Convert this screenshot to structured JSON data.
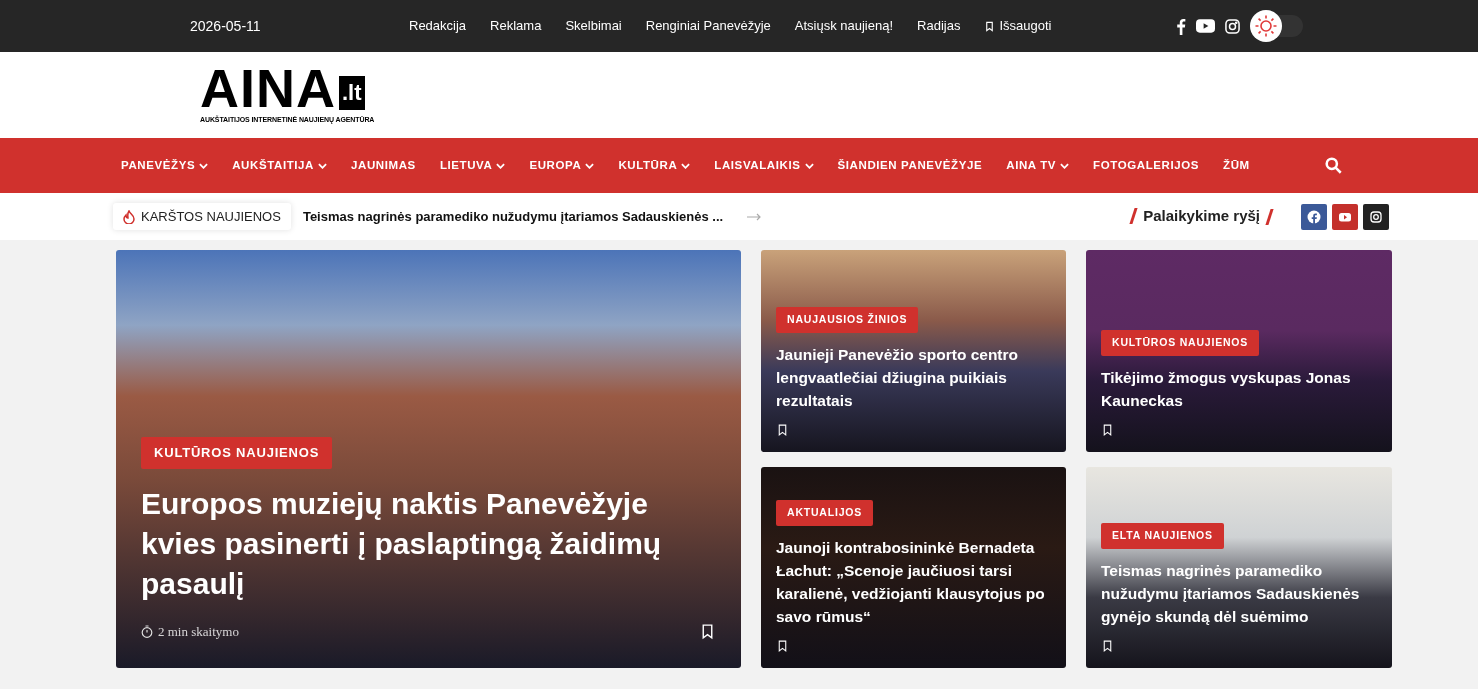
{
  "top_bar": {
    "date": "2026-05-11",
    "links": [
      {
        "label": "Redakcija"
      },
      {
        "label": "Reklama"
      },
      {
        "label": "Skelbimai"
      },
      {
        "label": "Renginiai Panevėžyje"
      },
      {
        "label": "Atsiųsk naujieną!"
      },
      {
        "label": "Radijas"
      },
      {
        "label": "Išsaugoti",
        "kind": "bookmark"
      }
    ],
    "dark_mode": false
  },
  "logo": {
    "name": "AINA",
    "tld": ".lt",
    "tagline": "AUKŠTAITIJOS INTERNETINĖ NAUJIENŲ AGENTŪRA"
  },
  "nav": [
    {
      "label": "PANEVĖŽYS",
      "has_dropdown": true
    },
    {
      "label": "AUKŠTAITIJA",
      "has_dropdown": true
    },
    {
      "label": "JAUNIMAS",
      "has_dropdown": false
    },
    {
      "label": "LIETUVA",
      "has_dropdown": true
    },
    {
      "label": "EUROPA",
      "has_dropdown": true
    },
    {
      "label": "KULTŪRA",
      "has_dropdown": true
    },
    {
      "label": "LAISVALAIKIS",
      "has_dropdown": true
    },
    {
      "label": "ŠIANDIEN PANEVĖŽYJE",
      "has_dropdown": false
    },
    {
      "label": "AINA TV",
      "has_dropdown": true
    },
    {
      "label": "FOTOGALERIJOS",
      "has_dropdown": false
    },
    {
      "label": "ŽŪM",
      "has_dropdown": false
    }
  ],
  "ticker": {
    "label": "KARŠTOS NAUJIENOS",
    "headline": "Teismas nagrinės paramediko nužudymu įtariamos Sadauskienės ..."
  },
  "social": {
    "title": "Palaikykime ryšį"
  },
  "featured": {
    "category": "KULTŪROS NAUJIENOS",
    "title": "Europos muziejų naktis Panevėžyje kvies pasinerti į paslaptingą žaidimų pasaulį",
    "read_time": "2 min skaitymo"
  },
  "articles": [
    {
      "category": "NAUJAUSIOS ŽINIOS",
      "title": "Jaunieji Panevėžio sporto centro lengvaatlečiai džiugina puikiais rezultatais"
    },
    {
      "category": "KULTŪROS NAUJIENOS",
      "title": "Tikėjimo žmogus vyskupas Jonas Kauneckas"
    },
    {
      "category": "AKTUALIJOS",
      "title": "Jaunoji kontrabosininkė Bernadeta Łachut: „Scenoje jaučiuosi tarsi karalienė, vedžiojanti klausytojus po savo rūmus“"
    },
    {
      "category": "ELTA NAUJIENOS",
      "title": "Teismas nagrinės paramediko nužudymu įtariamos Sadauskienės gynėjo skundą dėl suėmimo"
    }
  ]
}
